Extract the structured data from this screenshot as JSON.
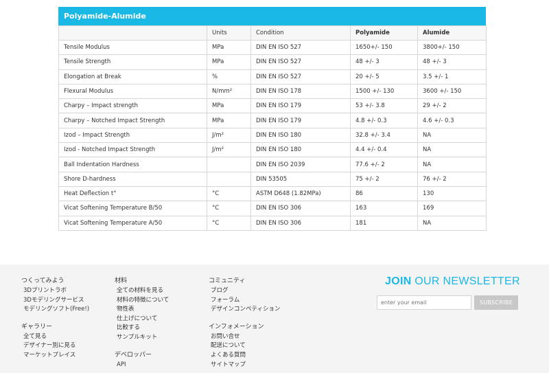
{
  "table": {
    "title": "Polyamide-Alumide",
    "headers": [
      "",
      "Units",
      "Condition",
      "Polyamide",
      "Alumide"
    ],
    "rows": [
      [
        "Tensile Modulus",
        "MPa",
        "DIN EN ISO 527",
        "1650+/- 150",
        "3800+/- 150"
      ],
      [
        "Tensile Strength",
        "MPa",
        "DIN EN ISO 527",
        "48 +/- 3",
        "48 +/- 3"
      ],
      [
        "Elongation at Break",
        "%",
        "DIN EN ISO 527",
        "20 +/- 5",
        "3.5 +/- 1"
      ],
      [
        "Flexural Modulus",
        "N/mm²",
        "DIN EN ISO 178",
        "1500 +/- 130",
        "3600 +/- 150"
      ],
      [
        "Charpy – Impact strength",
        "MPa",
        "DIN EN ISO 179",
        "53 +/- 3.8",
        "29 +/- 2"
      ],
      [
        "Charpy – Notched Impact Strength",
        "MPa",
        "DIN EN ISO 179",
        "4.8 +/- 0.3",
        "4.6 +/- 0.3"
      ],
      [
        "Izod – Impact Strength",
        "J/m²",
        "DIN EN ISO 180",
        "32.8 +/- 3.4",
        "NA"
      ],
      [
        "Izod - Notched Impact Strength",
        "J/m²",
        "DIN EN ISO 180",
        "4.4 +/- 0.4",
        "NA"
      ],
      [
        "Ball Indentation Hardness",
        "",
        "DIN EN ISO 2039",
        "77.6 +/- 2",
        "NA"
      ],
      [
        "Shore D-hardness",
        "",
        "DIN 53505",
        "75 +/- 2",
        "76 +/- 2"
      ],
      [
        "Heat Deflection t°",
        "°C",
        "ASTM D648 (1.82MPa)",
        "86",
        "130"
      ],
      [
        "Vicat Softening Temperature B/50",
        "°C",
        "DIN EN ISO 306",
        "163",
        "169"
      ],
      [
        "Vicat Softening Temperature A/50",
        "°C",
        "DIN EN ISO 306",
        "181",
        "NA"
      ]
    ]
  },
  "footer": {
    "columns": [
      {
        "groups": [
          {
            "heading": "つくってみよう",
            "items": [
              "3Dプリントラボ",
              "3Dモデリングサービス",
              "モデリングソフト(Free!)"
            ]
          },
          {
            "heading": "ギャラリー",
            "items": [
              "全て見る",
              "デザイナー別に見る",
              "マーケットプレイス"
            ]
          }
        ]
      },
      {
        "groups": [
          {
            "heading": "材料",
            "items": [
              "全ての材料を見る",
              "材料の特徴について",
              "物性表",
              "仕上げについて",
              "比較する",
              "サンプルキット"
            ]
          },
          {
            "heading": "デベロッパー",
            "items": [
              "API"
            ]
          }
        ]
      },
      {
        "groups": [
          {
            "heading": "コミュニティ",
            "items": [
              "ブログ",
              "フォーラム",
              "デザインコンペティション"
            ]
          },
          {
            "heading": "インフォメーション",
            "items": [
              "お問い合せ",
              "配送について",
              "よくある質問",
              "サイトマップ"
            ]
          }
        ]
      }
    ],
    "newsletter": {
      "title_bold": "JOIN",
      "title_rest": " OUR NEWSLETTER",
      "placeholder": "enter your email",
      "button": "SUBSCRIBE",
      "accent_color": "#1ab8e4"
    }
  }
}
